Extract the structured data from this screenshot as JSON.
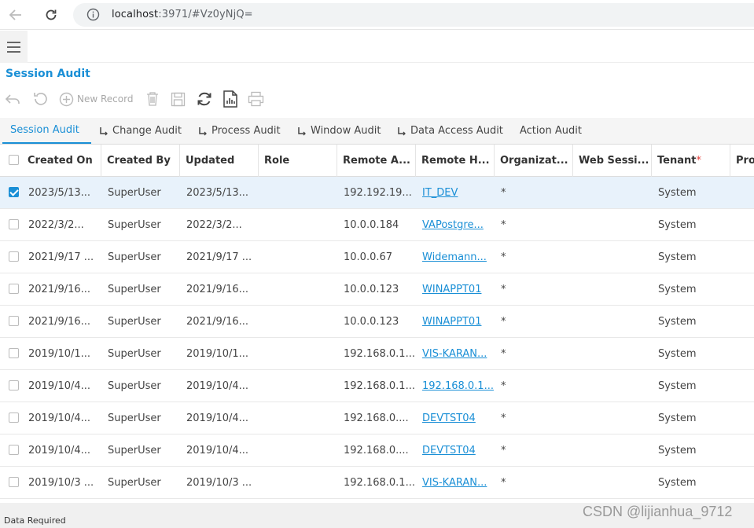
{
  "browser": {
    "url_host": "localhost",
    "url_rest": ":3971/#Vz0yNjQ="
  },
  "window": {
    "title": "Session Audit"
  },
  "toolbar": {
    "new_record_label": "New Record"
  },
  "tabs": [
    {
      "label": "Session Audit",
      "active": true
    },
    {
      "label": "Change Audit",
      "active": false
    },
    {
      "label": "Process Audit",
      "active": false
    },
    {
      "label": "Window Audit",
      "active": false
    },
    {
      "label": "Data Access Audit",
      "active": false
    },
    {
      "label": "Action Audit",
      "active": false
    }
  ],
  "grid": {
    "columns": [
      "Created On",
      "Created By",
      "Updated",
      "Role",
      "Remote A...",
      "Remote H...",
      "Organizat...",
      "Web Sessi...",
      "Tenant",
      "Pro"
    ],
    "tenant_required_mark": "*",
    "rows": [
      {
        "selected": true,
        "created_on": "2023/5/13...",
        "created_by": "SuperUser",
        "updated": "2023/5/13...",
        "role": "",
        "remote_addr": "192.192.19...",
        "remote_host": "IT_DEV",
        "org": "*",
        "web_session": "",
        "tenant": "System"
      },
      {
        "selected": false,
        "created_on": "2022/3/2...",
        "created_by": "SuperUser",
        "updated": "2022/3/2...",
        "role": "",
        "remote_addr": "10.0.0.184",
        "remote_host": "VAPostgre...",
        "org": "*",
        "web_session": "",
        "tenant": "System"
      },
      {
        "selected": false,
        "created_on": "2021/9/17 ...",
        "created_by": "SuperUser",
        "updated": "2021/9/17 ...",
        "role": "",
        "remote_addr": "10.0.0.67",
        "remote_host": "Widemann...",
        "org": "*",
        "web_session": "",
        "tenant": "System"
      },
      {
        "selected": false,
        "created_on": "2021/9/16...",
        "created_by": "SuperUser",
        "updated": "2021/9/16...",
        "role": "",
        "remote_addr": "10.0.0.123",
        "remote_host": "WINAPPT01",
        "org": "*",
        "web_session": "",
        "tenant": "System"
      },
      {
        "selected": false,
        "created_on": "2021/9/16...",
        "created_by": "SuperUser",
        "updated": "2021/9/16...",
        "role": "",
        "remote_addr": "10.0.0.123",
        "remote_host": "WINAPPT01",
        "org": "*",
        "web_session": "",
        "tenant": "System"
      },
      {
        "selected": false,
        "created_on": "2019/10/1...",
        "created_by": "SuperUser",
        "updated": "2019/10/1...",
        "role": "",
        "remote_addr": "192.168.0.1...",
        "remote_host": "VIS-KARAN...",
        "org": "*",
        "web_session": "",
        "tenant": "System"
      },
      {
        "selected": false,
        "created_on": "2019/10/4...",
        "created_by": "SuperUser",
        "updated": "2019/10/4...",
        "role": "",
        "remote_addr": "192.168.0.1...",
        "remote_host": "192.168.0.1...",
        "org": "*",
        "web_session": "",
        "tenant": "System"
      },
      {
        "selected": false,
        "created_on": "2019/10/4...",
        "created_by": "SuperUser",
        "updated": "2019/10/4...",
        "role": "",
        "remote_addr": "192.168.0....",
        "remote_host": "DEVTST04",
        "org": "*",
        "web_session": "",
        "tenant": "System"
      },
      {
        "selected": false,
        "created_on": "2019/10/4...",
        "created_by": "SuperUser",
        "updated": "2019/10/4...",
        "role": "",
        "remote_addr": "192.168.0....",
        "remote_host": "DEVTST04",
        "org": "*",
        "web_session": "",
        "tenant": "System"
      },
      {
        "selected": false,
        "created_on": "2019/10/3 ...",
        "created_by": "SuperUser",
        "updated": "2019/10/3 ...",
        "role": "",
        "remote_addr": "192.168.0.1...",
        "remote_host": "VIS-KARAN...",
        "org": "*",
        "web_session": "",
        "tenant": "System"
      }
    ]
  },
  "status": {
    "text": "Data Required"
  },
  "watermark": "CSDN @lijianhua_9712",
  "colors": {
    "accent": "#1a8fd6",
    "selected_row": "#e8f2fb"
  }
}
